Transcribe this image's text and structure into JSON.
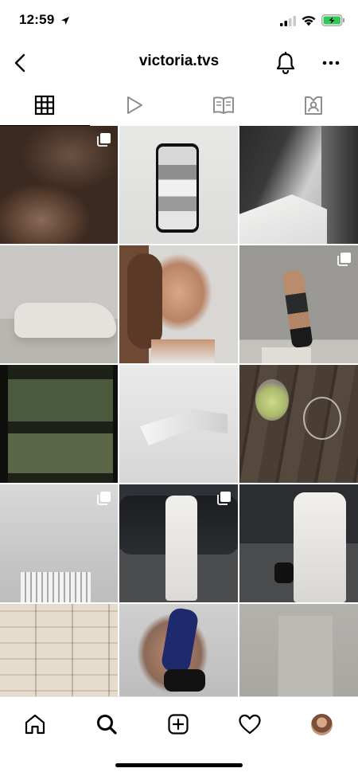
{
  "status_bar": {
    "time": "12:59",
    "icons": [
      "location-arrow-icon",
      "cellular-signal-icon",
      "wifi-icon",
      "battery-charging-icon"
    ],
    "battery_color": "#34c759"
  },
  "header": {
    "username": "victoria.tvs",
    "icons": [
      "back-chevron-icon",
      "bell-icon",
      "more-dots-icon"
    ]
  },
  "tabs": [
    {
      "id": "grid",
      "icon": "grid-icon",
      "active": true
    },
    {
      "id": "reels",
      "icon": "play-icon",
      "active": false
    },
    {
      "id": "guides",
      "icon": "book-icon",
      "active": false
    },
    {
      "id": "tagged",
      "icon": "tagged-person-icon",
      "active": false
    }
  ],
  "grid": {
    "columns": 3,
    "posts": [
      {
        "description": "close-up skin photo",
        "multiple": true
      },
      {
        "description": "phone on grey surface",
        "multiple": false
      },
      {
        "description": "neck and collar black and white",
        "multiple": false
      },
      {
        "description": "white curved sofa",
        "multiple": false
      },
      {
        "description": "selfie portrait",
        "multiple": false
      },
      {
        "description": "woman posing against wall",
        "multiple": true
      },
      {
        "description": "film frame foliage",
        "multiple": false
      },
      {
        "description": "white boots",
        "multiple": false
      },
      {
        "description": "wine glasses on wood",
        "multiple": false
      },
      {
        "description": "sky with building",
        "multiple": true
      },
      {
        "description": "white suit by car",
        "multiple": true
      },
      {
        "description": "white suit with bag",
        "multiple": false
      },
      {
        "description": "stacked cards",
        "multiple": false
      },
      {
        "description": "blue sleeve and boot",
        "multiple": false
      },
      {
        "description": "grey interior",
        "multiple": false
      }
    ]
  },
  "bottom_nav": {
    "items": [
      {
        "id": "home",
        "icon": "home-icon"
      },
      {
        "id": "search",
        "icon": "search-icon"
      },
      {
        "id": "create",
        "icon": "plus-square-icon"
      },
      {
        "id": "activity",
        "icon": "heart-icon"
      },
      {
        "id": "profile",
        "icon": "avatar-icon"
      }
    ]
  }
}
